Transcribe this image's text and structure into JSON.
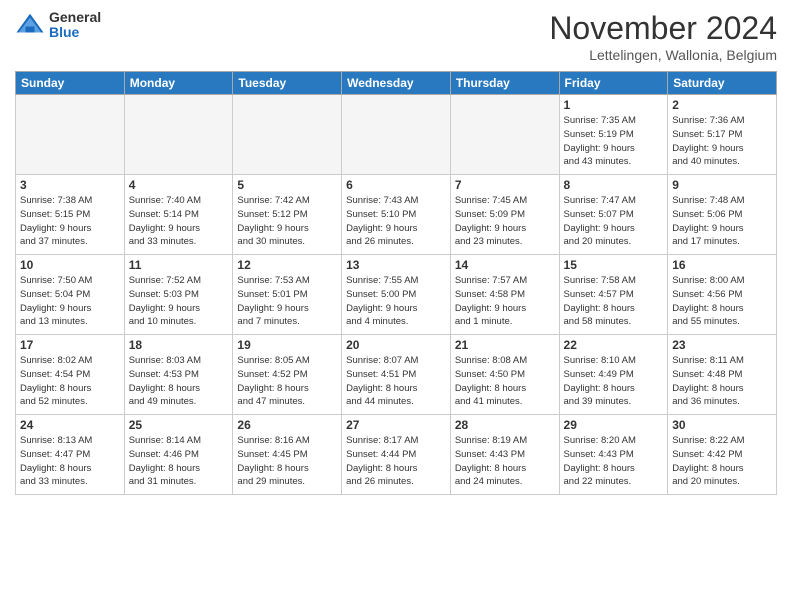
{
  "logo": {
    "general": "General",
    "blue": "Blue"
  },
  "title": "November 2024",
  "location": "Lettelingen, Wallonia, Belgium",
  "header_days": [
    "Sunday",
    "Monday",
    "Tuesday",
    "Wednesday",
    "Thursday",
    "Friday",
    "Saturday"
  ],
  "weeks": [
    [
      {
        "day": "",
        "info": ""
      },
      {
        "day": "",
        "info": ""
      },
      {
        "day": "",
        "info": ""
      },
      {
        "day": "",
        "info": ""
      },
      {
        "day": "",
        "info": ""
      },
      {
        "day": "1",
        "info": "Sunrise: 7:35 AM\nSunset: 5:19 PM\nDaylight: 9 hours\nand 43 minutes."
      },
      {
        "day": "2",
        "info": "Sunrise: 7:36 AM\nSunset: 5:17 PM\nDaylight: 9 hours\nand 40 minutes."
      }
    ],
    [
      {
        "day": "3",
        "info": "Sunrise: 7:38 AM\nSunset: 5:15 PM\nDaylight: 9 hours\nand 37 minutes."
      },
      {
        "day": "4",
        "info": "Sunrise: 7:40 AM\nSunset: 5:14 PM\nDaylight: 9 hours\nand 33 minutes."
      },
      {
        "day": "5",
        "info": "Sunrise: 7:42 AM\nSunset: 5:12 PM\nDaylight: 9 hours\nand 30 minutes."
      },
      {
        "day": "6",
        "info": "Sunrise: 7:43 AM\nSunset: 5:10 PM\nDaylight: 9 hours\nand 26 minutes."
      },
      {
        "day": "7",
        "info": "Sunrise: 7:45 AM\nSunset: 5:09 PM\nDaylight: 9 hours\nand 23 minutes."
      },
      {
        "day": "8",
        "info": "Sunrise: 7:47 AM\nSunset: 5:07 PM\nDaylight: 9 hours\nand 20 minutes."
      },
      {
        "day": "9",
        "info": "Sunrise: 7:48 AM\nSunset: 5:06 PM\nDaylight: 9 hours\nand 17 minutes."
      }
    ],
    [
      {
        "day": "10",
        "info": "Sunrise: 7:50 AM\nSunset: 5:04 PM\nDaylight: 9 hours\nand 13 minutes."
      },
      {
        "day": "11",
        "info": "Sunrise: 7:52 AM\nSunset: 5:03 PM\nDaylight: 9 hours\nand 10 minutes."
      },
      {
        "day": "12",
        "info": "Sunrise: 7:53 AM\nSunset: 5:01 PM\nDaylight: 9 hours\nand 7 minutes."
      },
      {
        "day": "13",
        "info": "Sunrise: 7:55 AM\nSunset: 5:00 PM\nDaylight: 9 hours\nand 4 minutes."
      },
      {
        "day": "14",
        "info": "Sunrise: 7:57 AM\nSunset: 4:58 PM\nDaylight: 9 hours\nand 1 minute."
      },
      {
        "day": "15",
        "info": "Sunrise: 7:58 AM\nSunset: 4:57 PM\nDaylight: 8 hours\nand 58 minutes."
      },
      {
        "day": "16",
        "info": "Sunrise: 8:00 AM\nSunset: 4:56 PM\nDaylight: 8 hours\nand 55 minutes."
      }
    ],
    [
      {
        "day": "17",
        "info": "Sunrise: 8:02 AM\nSunset: 4:54 PM\nDaylight: 8 hours\nand 52 minutes."
      },
      {
        "day": "18",
        "info": "Sunrise: 8:03 AM\nSunset: 4:53 PM\nDaylight: 8 hours\nand 49 minutes."
      },
      {
        "day": "19",
        "info": "Sunrise: 8:05 AM\nSunset: 4:52 PM\nDaylight: 8 hours\nand 47 minutes."
      },
      {
        "day": "20",
        "info": "Sunrise: 8:07 AM\nSunset: 4:51 PM\nDaylight: 8 hours\nand 44 minutes."
      },
      {
        "day": "21",
        "info": "Sunrise: 8:08 AM\nSunset: 4:50 PM\nDaylight: 8 hours\nand 41 minutes."
      },
      {
        "day": "22",
        "info": "Sunrise: 8:10 AM\nSunset: 4:49 PM\nDaylight: 8 hours\nand 39 minutes."
      },
      {
        "day": "23",
        "info": "Sunrise: 8:11 AM\nSunset: 4:48 PM\nDaylight: 8 hours\nand 36 minutes."
      }
    ],
    [
      {
        "day": "24",
        "info": "Sunrise: 8:13 AM\nSunset: 4:47 PM\nDaylight: 8 hours\nand 33 minutes."
      },
      {
        "day": "25",
        "info": "Sunrise: 8:14 AM\nSunset: 4:46 PM\nDaylight: 8 hours\nand 31 minutes."
      },
      {
        "day": "26",
        "info": "Sunrise: 8:16 AM\nSunset: 4:45 PM\nDaylight: 8 hours\nand 29 minutes."
      },
      {
        "day": "27",
        "info": "Sunrise: 8:17 AM\nSunset: 4:44 PM\nDaylight: 8 hours\nand 26 minutes."
      },
      {
        "day": "28",
        "info": "Sunrise: 8:19 AM\nSunset: 4:43 PM\nDaylight: 8 hours\nand 24 minutes."
      },
      {
        "day": "29",
        "info": "Sunrise: 8:20 AM\nSunset: 4:43 PM\nDaylight: 8 hours\nand 22 minutes."
      },
      {
        "day": "30",
        "info": "Sunrise: 8:22 AM\nSunset: 4:42 PM\nDaylight: 8 hours\nand 20 minutes."
      }
    ]
  ]
}
